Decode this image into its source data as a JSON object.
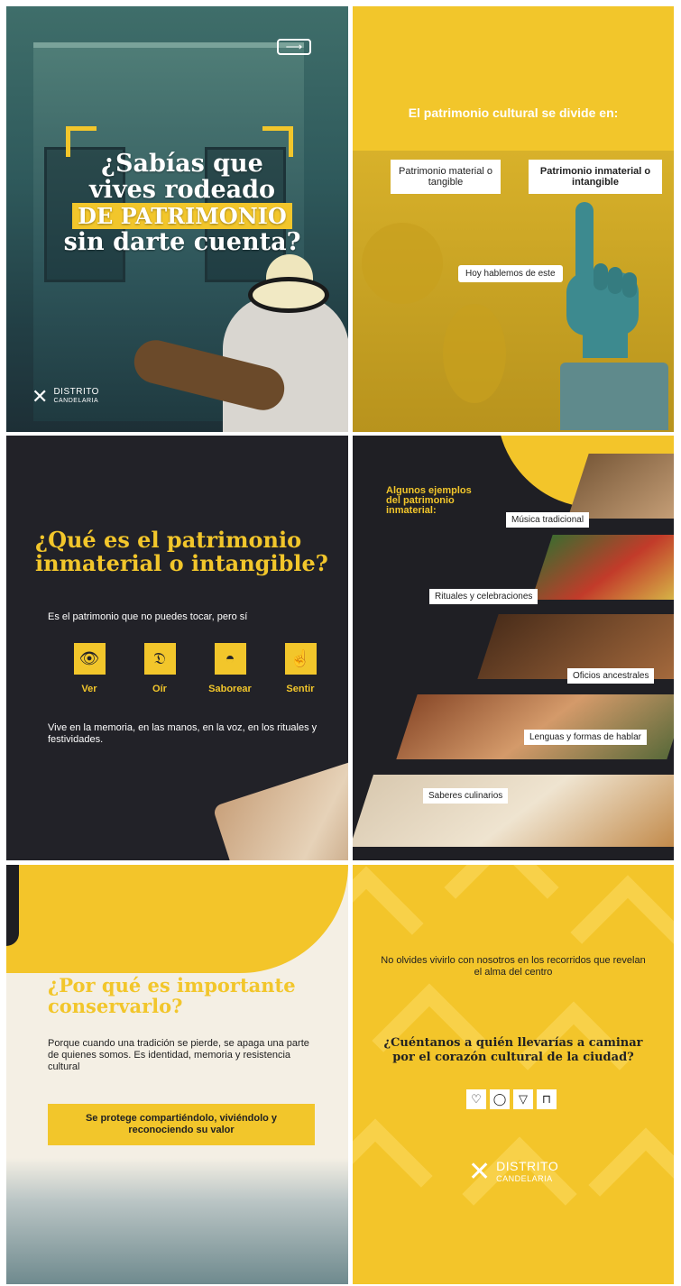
{
  "panel1": {
    "arrow": "⟶",
    "title_line1": "¿Sabías que",
    "title_line2": "vives rodeado",
    "title_highlight": "DE PATRIMONIO",
    "title_line4": "sin darte cuenta?",
    "logo_name": "DISTRITO",
    "logo_sub": "CANDELARIA"
  },
  "panel2": {
    "header": "El patrimonio cultural se divide en:",
    "option1": "Patrimonio material o tangible",
    "option2": "Patrimonio inmaterial o intangible",
    "bubble": "Hoy hablemos de este"
  },
  "panel3": {
    "title": "¿Qué es el patrimonio inmaterial o intangible?",
    "subtitle": "Es el patrimonio que no puedes tocar, pero sí",
    "senses": [
      {
        "label": "Ver",
        "icon": "eye-icon",
        "glyph": "👁"
      },
      {
        "label": "Oír",
        "icon": "ear-icon",
        "glyph": "𝔇"
      },
      {
        "label": "Saborear",
        "icon": "lips-icon",
        "glyph": "◓"
      },
      {
        "label": "Sentir",
        "icon": "hand-icon",
        "glyph": "☝"
      }
    ],
    "text": "Vive en la memoria, en las manos, en la voz, en los rituales y festividades."
  },
  "panel4": {
    "title": "Algunos ejemplos del patrimonio inmaterial:",
    "examples": [
      "Música tradicional",
      "Rituales y celebraciones",
      "Oficios ancestrales",
      "Lenguas y formas de hablar",
      "Saberes culinarios"
    ]
  },
  "panel5": {
    "title": "¿Por qué es importante conservarlo?",
    "text": "Porque cuando una tradición se pierde, se apaga una parte de quienes somos. Es identidad, memoria y resistencia cultural",
    "cta": "Se protege compartiéndolo, viviéndolo y reconociendo su valor"
  },
  "panel6": {
    "text": "No olvides vivirlo con nosotros en los recorridos que revelan el alma del centro",
    "question": "¿Cuéntanos a quién llevarías a caminar por el corazón cultural de la ciudad?",
    "actions": [
      "♡",
      "◯",
      "▽",
      "⊓"
    ],
    "logo_name": "DISTRITO",
    "logo_sub": "CANDELARIA"
  },
  "colors": {
    "yellow": "#f2c62b",
    "dark": "#222228",
    "cream": "#f4efe4",
    "teal": "#2f5a5c"
  }
}
